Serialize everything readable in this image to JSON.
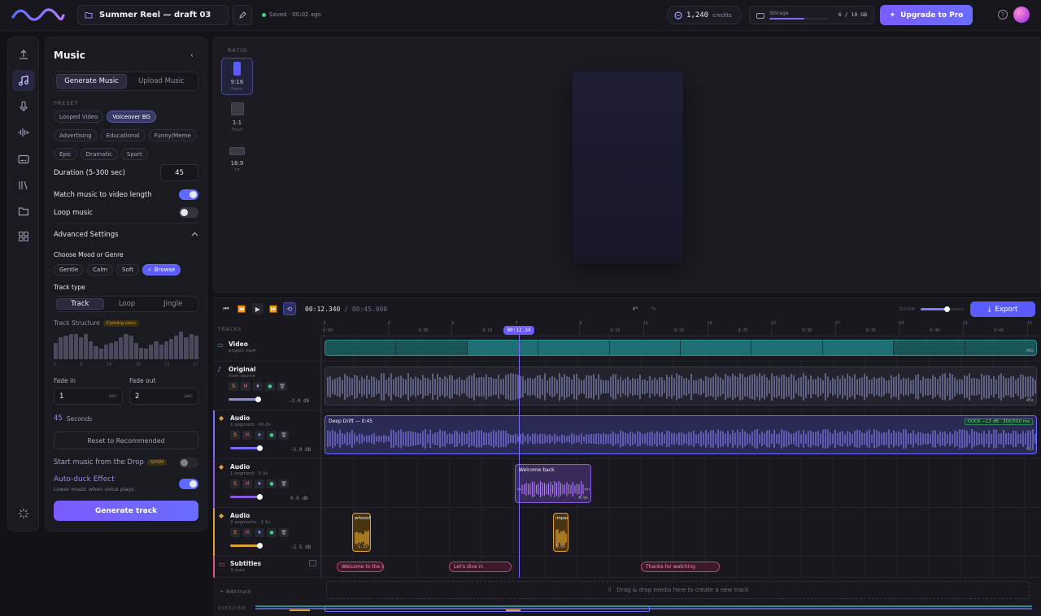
{
  "topbar": {
    "project_title": "Summer Reel — draft 03",
    "saved_status": "Saved · 00:02 ago",
    "credits_value": "1,240",
    "credits_label": "credits",
    "storage_label": "Storage",
    "storage_value": "6 / 10 GB",
    "storage_fraction": 0.6,
    "upgrade_label": "Upgrade to Pro",
    "help_glyph": "?"
  },
  "rail": {
    "icons": [
      "upload-icon",
      "music-icon",
      "microphone-icon",
      "waveform-icon",
      "subtitles-icon",
      "library-icon",
      "folder-icon",
      "templates-icon",
      "effects-icon"
    ]
  },
  "music_panel": {
    "title": "Music",
    "tabs": [
      {
        "label": "Generate Music",
        "active": true
      },
      {
        "label": "Upload Music",
        "active": false
      }
    ],
    "preset_caption": "PRESET",
    "presets": [
      {
        "label": "Looped Video",
        "active": false
      },
      {
        "label": "Voiceover BG",
        "active": true
      },
      {
        "label": "Advertising",
        "active": false
      },
      {
        "label": "Educational",
        "active": false
      },
      {
        "label": "Funny/Meme",
        "active": false
      },
      {
        "label": "Epic",
        "active": false
      },
      {
        "label": "Dramatic",
        "active": false
      },
      {
        "label": "Sport",
        "active": false
      }
    ],
    "duration_label": "Duration (5-300 sec)",
    "duration_value": "45",
    "match_label": "Match music to video length",
    "match_on": true,
    "loop_label": "Loop music",
    "loop_on": false,
    "advanced_label": "Advanced Settings",
    "mood_label": "Choose Mood or Genre",
    "moods": [
      {
        "label": "Gentle",
        "active": false
      },
      {
        "label": "Calm",
        "active": false
      },
      {
        "label": "Soft",
        "active": false
      },
      {
        "label": "Browse",
        "active": true
      }
    ],
    "track_type_label": "Track type",
    "track_types": [
      {
        "label": "Track",
        "active": true
      },
      {
        "label": "Loop",
        "active": false
      },
      {
        "label": "Jingle",
        "active": false
      }
    ],
    "structure_label": "Track Structure",
    "structure_badge": "Coming soon",
    "structure_bars": [
      0.55,
      0.75,
      0.8,
      0.85,
      0.85,
      0.75,
      0.85,
      0.6,
      0.45,
      0.35,
      0.5,
      0.55,
      0.6,
      0.75,
      0.85,
      0.8,
      0.55,
      0.4,
      0.35,
      0.5,
      0.6,
      0.5,
      0.6,
      0.7,
      0.8,
      0.95,
      0.75,
      0.85,
      0.8
    ],
    "structure_ticks": [
      "5",
      "9",
      "14",
      "18",
      "23",
      "27"
    ],
    "fade_in_label": "Fade in",
    "fade_in_value": "1",
    "fade_out_label": "Fade out",
    "fade_out_value": "2",
    "fade_unit": "sec",
    "seconds_value": "45",
    "seconds_label": "Seconds",
    "reset_label": "Reset to Recommended",
    "drop_label": "Start music from the Drop",
    "drop_badge": "SOON",
    "drop_on": false,
    "duck_label": "Auto-duck Effect",
    "duck_sub": "Lower music when voice plays",
    "duck_on": true,
    "generate_label": "Generate track"
  },
  "preview": {
    "ratio_caption": "RATIO",
    "ratios": [
      {
        "label": "9:16",
        "sub": "Reels",
        "active": true
      },
      {
        "label": "1:1",
        "sub": "Feed",
        "active": false
      },
      {
        "label": "16:9",
        "sub": "YT",
        "active": false
      }
    ]
  },
  "timeline": {
    "current_time": "00:12.340",
    "total_time": "/ 00:45.000",
    "zoom_label": "ZOOM",
    "zoom_level": 0.6,
    "export_label": "Export",
    "tracks_caption": "TRACKS",
    "playhead_label": "00:12.34",
    "ruler": [
      {
        "n": "1",
        "t": "0:00"
      },
      {
        "n": "3",
        "t": "0:05"
      },
      {
        "n": "5",
        "t": "0:10"
      },
      {
        "n": "7",
        "t": ""
      },
      {
        "n": "9",
        "t": "0:15"
      },
      {
        "n": "11",
        "t": "0:20"
      },
      {
        "n": "13",
        "t": "0:25"
      },
      {
        "n": "15",
        "t": "0:30"
      },
      {
        "n": "17",
        "t": "0:35"
      },
      {
        "n": "19",
        "t": "0:40"
      },
      {
        "n": "21",
        "t": "0:45"
      },
      {
        "n": "23",
        "t": ""
      }
    ],
    "tracks": {
      "video": {
        "name": "Video",
        "sub": "project.mp4",
        "len": "45s"
      },
      "original": {
        "name": "Original",
        "sub": "from source",
        "db": "-2.0 dB",
        "len": "45s"
      },
      "audio1": {
        "name": "Audio",
        "sub": "1 segment · 45.0s",
        "db": "-5.0 dB",
        "clip": "Deep Drift — 0:45",
        "duck": "DUCK −12 dB · 300/500 ms",
        "len": "45s"
      },
      "audio2": {
        "name": "Audio",
        "sub": "1 segment · 5.0s",
        "db": "0.0 dB",
        "clip": "Welcome back",
        "len": "4.9s"
      },
      "audio3": {
        "name": "Audio",
        "sub": "2 segments · 2.1s",
        "db": "-2.5 dB",
        "clip1": "whoosh",
        "len1": "1.1s",
        "clip2": "impact",
        "len2": "1.0s"
      },
      "subtitles": {
        "name": "Subtitles",
        "sub": "3 cues",
        "cues": [
          "Welcome to the st",
          "Let's dive in",
          "Thanks for watching"
        ]
      }
    },
    "ctl_labels": [
      "S",
      "M"
    ],
    "add_track": "+ Add track",
    "drop_hint": "Drag & drop media here to create a new track",
    "overview_caption": "OVERVIEW"
  },
  "colors": {
    "accent": "#5b5cff",
    "video": "#1f8b8b",
    "original": "#6d74a8",
    "music": "#7a6cff",
    "voice": "#8a5ce0",
    "sfx": "#e0a030",
    "subs": "#e0508a"
  }
}
